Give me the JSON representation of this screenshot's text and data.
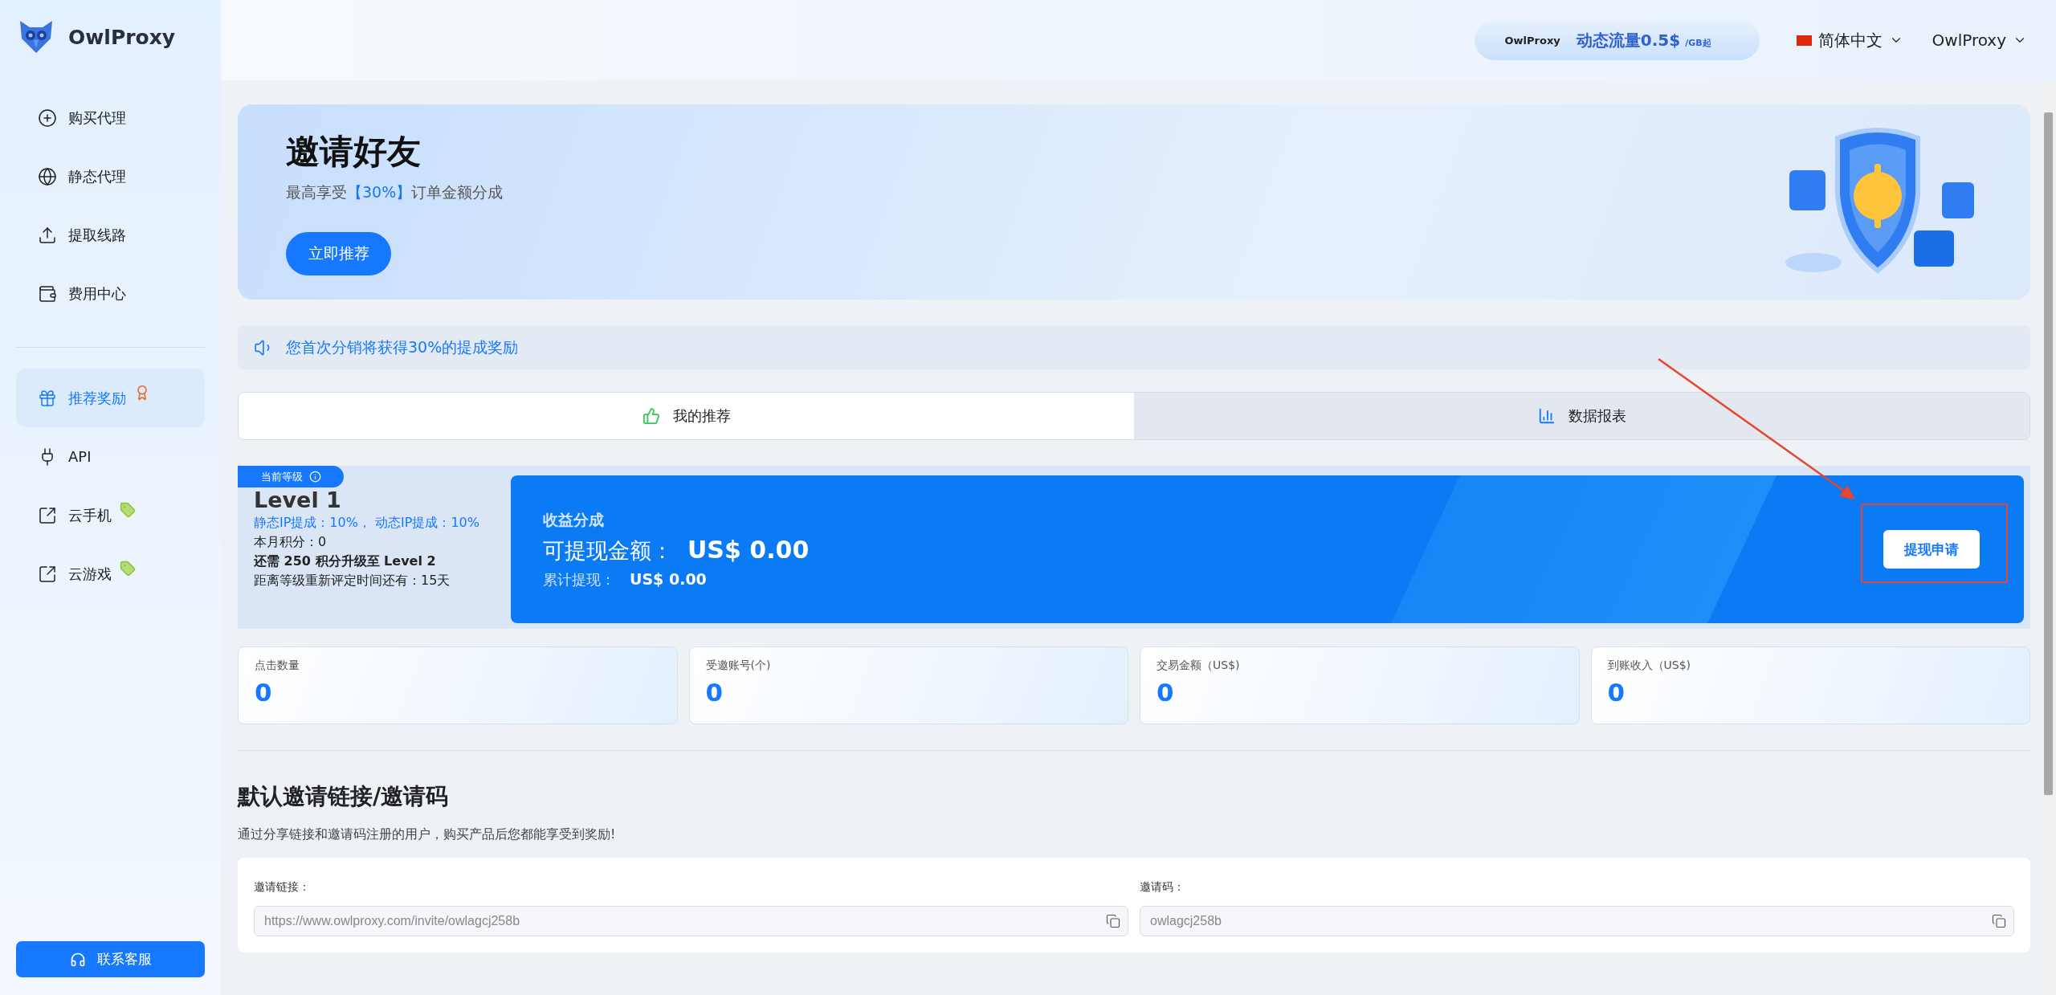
{
  "sidebar": {
    "logo": "OwlProxy",
    "items": [
      {
        "label": "购买代理",
        "selected": false,
        "kind": "plain"
      },
      {
        "label": "静态代理",
        "selected": false,
        "kind": "plain"
      },
      {
        "label": "提取线路",
        "selected": false,
        "kind": "plain"
      },
      {
        "label": "费用中心",
        "selected": false,
        "kind": "plain"
      },
      {
        "label": "推荐奖励",
        "selected": true,
        "kind": "award"
      },
      {
        "label": "API",
        "selected": false,
        "kind": "plain"
      },
      {
        "label": "云手机",
        "selected": false,
        "kind": "tag"
      },
      {
        "label": "云游戏",
        "selected": false,
        "kind": "tag"
      }
    ],
    "support_button": "联系客服"
  },
  "header": {
    "promo": {
      "brand": "OwlProxy",
      "headline": "动态流量0.5$",
      "unit": "/GB起"
    },
    "language": "简体中文",
    "user": "OwlProxy"
  },
  "banner": {
    "title": "邀请好友",
    "subtitle": {
      "before": "最高享受",
      "highlight": "【30%】",
      "after": "订单金额分成"
    },
    "button": "立即推荐"
  },
  "notice": "您首次分销将获得30%的提成奖励",
  "tabs": [
    {
      "label": "我的推荐",
      "selected": true
    },
    {
      "label": "数据报表",
      "selected": false
    }
  ],
  "level": {
    "tag": "当前等级",
    "name": "Level 1",
    "commission": "静态IP提成：10%， 动态IP提成：10%",
    "points": "本月积分：0",
    "upgrade": "还需 250 积分升级至 Level 2",
    "reset": "距离等级重新评定时间还有：15天"
  },
  "earnings": {
    "title": "收益分成",
    "available_label": "可提现金额：",
    "available_value": "US$ 0.00",
    "total_label": "累计提现：",
    "total_value": "US$ 0.00",
    "button": "提现申请"
  },
  "stats": [
    {
      "label": "点击数量",
      "value": "0"
    },
    {
      "label": "受邀账号(个)",
      "value": "0"
    },
    {
      "label": "交易金额（US$)",
      "value": "0"
    },
    {
      "label": "到账收入（US$)",
      "value": "0"
    }
  ],
  "invite": {
    "title": "默认邀请链接/邀请码",
    "description": "通过分享链接和邀请码注册的用户，购买产品后您都能享受到奖励!",
    "fields": [
      {
        "label": "邀请链接：",
        "value": "https://www.owlproxy.com/invite/owlagcj258b"
      },
      {
        "label": "邀请码：",
        "value": "owlagcj258b"
      }
    ]
  }
}
